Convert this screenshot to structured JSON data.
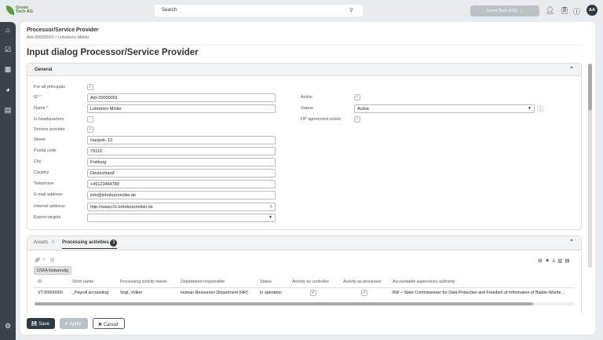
{
  "header": {
    "logo": "Green Tech AG",
    "search_placeholder": "Search",
    "tenant": "GreenTech (DS)",
    "avatar": "AA"
  },
  "breadcrumb": {
    "title": "Processor/Service Provider",
    "sub": "Adr-00000001 • Lohnbüro Müller"
  },
  "page_title": "Input dialog Processor/Service Provider",
  "general": {
    "title": "General",
    "fields": [
      {
        "label": "For all principals",
        "type": "checkbox",
        "checked": true
      },
      {
        "label": "ID *",
        "value": "Adr-00000001"
      },
      {
        "label": "Name *",
        "value": "Lohnbüro Müller"
      },
      {
        "label": "Is headquarters",
        "type": "checkbox",
        "checked": false
      },
      {
        "label": "Service provider",
        "type": "checkbox",
        "checked": true
      },
      {
        "label": "Street",
        "value": "Haupstr. 12"
      },
      {
        "label": "Postal code",
        "value": "79110"
      },
      {
        "label": "City",
        "value": "Freiburg"
      },
      {
        "label": "Country",
        "value": "Deutschland"
      },
      {
        "label": "Telephone",
        "value": "+49123464789"
      },
      {
        "label": "E-mail address",
        "value": "info@lohnbüromüller.de"
      },
      {
        "label": "Internet address",
        "value": "http://www.r2c.lohnbüromüller.de"
      },
      {
        "label": "Export targets",
        "value": ""
      }
    ],
    "right": {
      "active_label": "Active",
      "status_label": "Status",
      "status_value": "Active",
      "dp_label": "DP agreement exists"
    }
  },
  "tabs": {
    "assets": "Assets",
    "assets_count": "0",
    "processing": "Processing activities",
    "processing_count": "1",
    "dsfa_button": "DSFA Notwendig"
  },
  "table": {
    "columns": [
      "ID",
      "Short name",
      "Processing activity owner",
      "Department responsible",
      "Status",
      "Activity as controller",
      "Activity as processor",
      "Accountable supervisory authority"
    ],
    "rows": [
      [
        "VT-00000000",
        "_Payroll accounting",
        "Vogt, Volker",
        "Human Resources Department (HR)",
        "In operation",
        "✓",
        "✓",
        "BW – State Commissioner for Data Protection and Freedom of Information of Baden-Württe..."
      ]
    ]
  },
  "footer": {
    "save": "Save",
    "apply": "Apply",
    "cancel": "Cancel"
  }
}
